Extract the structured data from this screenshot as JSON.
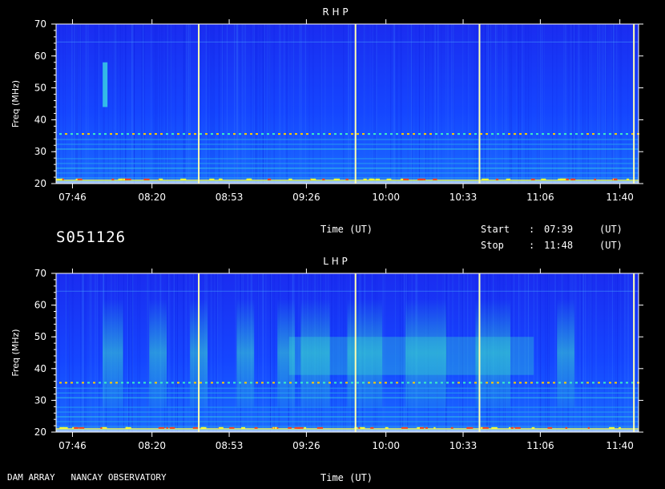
{
  "header": {
    "session_id": "S051126",
    "time_axis_label": "Time (UT)",
    "start_label": "Start",
    "start_sep": ":",
    "start_time": "07:39",
    "start_unit": "(UT)",
    "stop_label": "Stop",
    "stop_sep": ":",
    "stop_time": "11:48",
    "stop_unit": "(UT)"
  },
  "footer": {
    "instrument": "DAM ARRAY   NANCAY OBSERVATORY",
    "time_axis_label": "Time (UT)"
  },
  "chart_data": [
    {
      "type": "heatmap",
      "title": "R H P",
      "ylabel": "Freq (MHz)",
      "xlabel": "",
      "ylim": [
        20,
        70
      ],
      "yticks": [
        20,
        30,
        40,
        50,
        60,
        70
      ],
      "xticks": [
        "07:46",
        "08:20",
        "08:53",
        "09:26",
        "10:00",
        "10:33",
        "11:06",
        "11:40"
      ],
      "x_range": [
        "07:39",
        "11:48"
      ],
      "markers_ut": [
        "08:40",
        "09:47",
        "10:40",
        "11:46"
      ],
      "colors": {
        "background": "#1038ff",
        "hot": "#ffff00",
        "warm": "#30e8c8",
        "cold": "#0a1ee0"
      }
    },
    {
      "type": "heatmap",
      "title": "L H P",
      "ylabel": "Freq (MHz)",
      "xlabel": "",
      "ylim": [
        20,
        70
      ],
      "yticks": [
        20,
        30,
        40,
        50,
        60,
        70
      ],
      "xticks": [
        "07:46",
        "08:20",
        "08:53",
        "09:26",
        "10:00",
        "10:33",
        "11:06",
        "11:40"
      ],
      "x_range": [
        "07:39",
        "11:48"
      ],
      "markers_ut": [
        "08:40",
        "09:47",
        "10:40",
        "11:46"
      ],
      "colors": {
        "background": "#1038ff",
        "hot": "#ffff00",
        "warm": "#30e8c8",
        "cold": "#0a1ee0"
      }
    }
  ]
}
